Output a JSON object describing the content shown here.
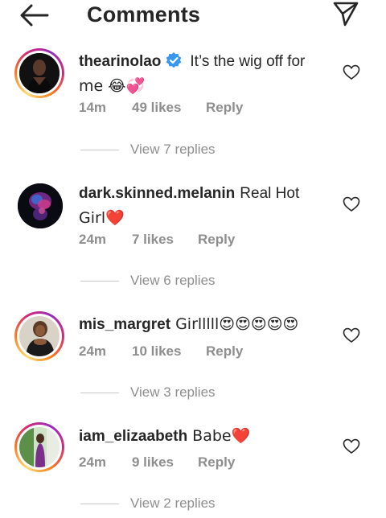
{
  "header": {
    "title": "Comments",
    "back_icon": "arrow-left-icon",
    "share_icon": "paper-plane-icon"
  },
  "comments": [
    {
      "username": "thearinolao",
      "verified": true,
      "text": "It’s the wig off for me 😂💞",
      "text_line1": "It’s the wig off for",
      "text_line2": "me 😂💞",
      "time": "14m",
      "likes": "49 likes",
      "reply": "Reply",
      "view_replies": "View 7 replies",
      "story_ring": true
    },
    {
      "username": "dark.skinned.melanin",
      "verified": false,
      "text": "Real Hot Girl❤️",
      "text_line1": "Real Hot",
      "text_line2": "Girl❤️",
      "time": "24m",
      "likes": "7 likes",
      "reply": "Reply",
      "view_replies": "View 6 replies",
      "story_ring": false
    },
    {
      "username": "mis_margret",
      "verified": false,
      "text": "Girlllll😍😍😍😍😍",
      "time": "24m",
      "likes": "10 likes",
      "reply": "Reply",
      "view_replies": "View 3 replies",
      "story_ring": true
    },
    {
      "username": "iam_elizaabeth",
      "verified": false,
      "text": "Babe❤️",
      "time": "24m",
      "likes": "9 likes",
      "reply": "Reply",
      "view_replies": "View 2 replies",
      "story_ring": true
    }
  ],
  "colors": {
    "text": "#262626",
    "muted": "#8e8e8e",
    "verified_blue": "#3897f0",
    "heart_red": "#e0202f"
  }
}
